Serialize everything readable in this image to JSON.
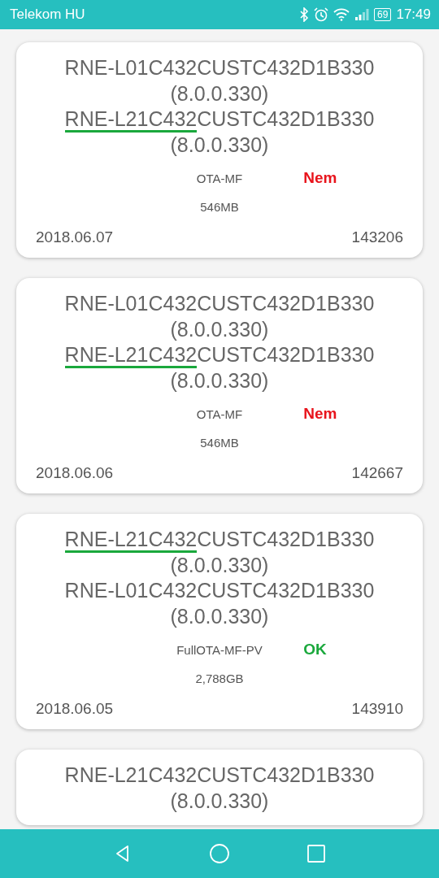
{
  "status_bar": {
    "carrier": "Telekom HU",
    "battery": "69",
    "time": "17:49"
  },
  "cards": [
    {
      "firmwares": [
        {
          "head": "RNE-L01C432",
          "tail": "CUSTC432D1B330",
          "version": "(8.0.0.330)",
          "underlined": false
        },
        {
          "head": "RNE-L21C432",
          "tail": "CUSTC432D1B330",
          "version": "(8.0.0.330)",
          "underlined": true
        }
      ],
      "type": "OTA-MF",
      "status": {
        "text": "Nem",
        "kind": "fail"
      },
      "size": "546MB",
      "date": "2018.06.07",
      "id": "143206"
    },
    {
      "firmwares": [
        {
          "head": "RNE-L01C432",
          "tail": "CUSTC432D1B330",
          "version": "(8.0.0.330)",
          "underlined": false
        },
        {
          "head": "RNE-L21C432",
          "tail": "CUSTC432D1B330",
          "version": "(8.0.0.330)",
          "underlined": true
        }
      ],
      "type": "OTA-MF",
      "status": {
        "text": "Nem",
        "kind": "fail"
      },
      "size": "546MB",
      "date": "2018.06.06",
      "id": "142667"
    },
    {
      "firmwares": [
        {
          "head": "RNE-L21C432",
          "tail": "CUSTC432D1B330",
          "version": "(8.0.0.330)",
          "underlined": true
        },
        {
          "head": "RNE-L01C432",
          "tail": "CUSTC432D1B330",
          "version": "(8.0.0.330)",
          "underlined": false
        }
      ],
      "type": "FullOTA-MF-PV",
      "status": {
        "text": "OK",
        "kind": "ok"
      },
      "size": "2,788GB",
      "date": "2018.06.05",
      "id": "143910"
    },
    {
      "firmwares": [
        {
          "head": "RNE-L21C432",
          "tail": "CUSTC432D1B330",
          "version": "(8.0.0.330)",
          "underlined": false
        }
      ]
    }
  ]
}
